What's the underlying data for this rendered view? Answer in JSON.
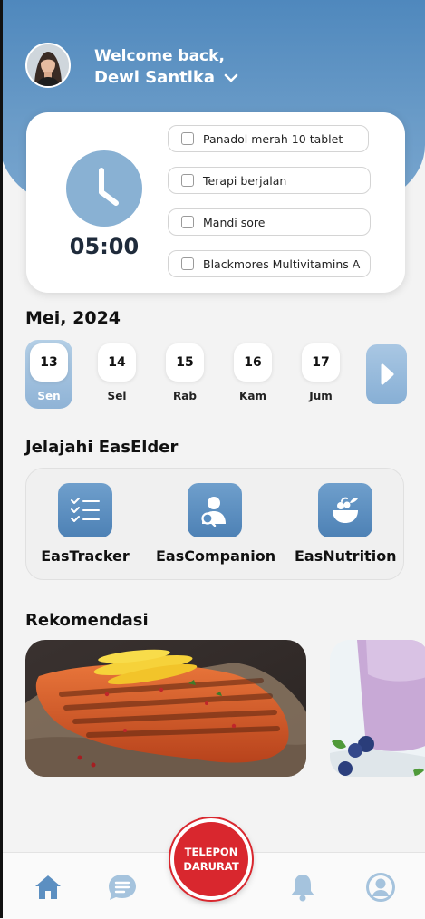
{
  "header": {
    "welcome": "Welcome back,",
    "user_name": "Dewi Santika",
    "avatar_icon": "user-photo",
    "color": "#5a8fc2"
  },
  "schedule": {
    "time": "05:00",
    "clock_icon": "clock-icon",
    "tasks": [
      {
        "label": "Panadol merah 10 tablet",
        "checked": false
      },
      {
        "label": "Terapi berjalan",
        "checked": false
      },
      {
        "label": "Mandi sore",
        "checked": false
      },
      {
        "label": "Blackmores Multivitamins A",
        "checked": false
      }
    ]
  },
  "calendar": {
    "month": "Mei, 2024",
    "days": [
      {
        "num": "13",
        "name": "Sen",
        "active": true
      },
      {
        "num": "14",
        "name": "Sel",
        "active": false
      },
      {
        "num": "15",
        "name": "Rab",
        "active": false
      },
      {
        "num": "16",
        "name": "Kam",
        "active": false
      },
      {
        "num": "17",
        "name": "Jum",
        "active": false
      }
    ],
    "next_icon": "chevron-right-icon"
  },
  "explore": {
    "title": "Jelajahi EasElder",
    "features": [
      {
        "label": "EasTracker",
        "icon": "checklist-icon"
      },
      {
        "label": "EasCompanion",
        "icon": "companion-icon"
      },
      {
        "label": "EasNutrition",
        "icon": "food-bowl-icon"
      }
    ]
  },
  "recommendation": {
    "title": "Rekomendasi",
    "items": [
      {
        "image": "grilled-salmon-image"
      },
      {
        "image": "smoothie-blueberry-image"
      }
    ]
  },
  "navbar": {
    "emergency_line1": "TELEPON",
    "emergency_line2": "DARURAT",
    "emergency_color": "#d9272e",
    "icons": [
      "home-icon",
      "chat-icon",
      "bell-icon",
      "profile-icon"
    ],
    "accent": "#6a9cca"
  }
}
